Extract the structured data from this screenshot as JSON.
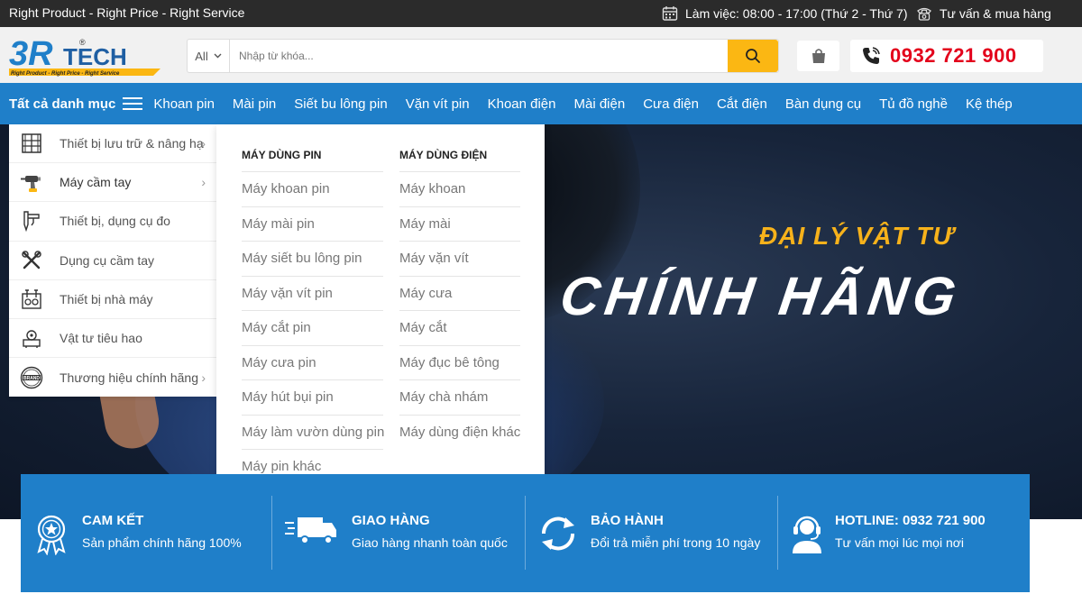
{
  "topbar": {
    "slogan": "Right Product - Right Price - Right Service",
    "hours": "Làm việc: 08:00 - 17:00 (Thứ 2 - Thứ 7)",
    "consult": "Tư vấn & mua hàng"
  },
  "header": {
    "logo_text": "3R TECH",
    "logo_tagline": "Right Product - Right Price - Right Service",
    "search_category": "All",
    "search_placeholder": "Nhập từ khóa...",
    "phone": "0932 721 900"
  },
  "nav": {
    "all_categories": "Tất cả danh mục",
    "items": [
      "Khoan pin",
      "Mài pin",
      "Siết bu lông pin",
      "Vặn vít pin",
      "Khoan điện",
      "Mài điện",
      "Cưa điện",
      "Cắt điện",
      "Bàn dụng cụ",
      "Tủ đồ nghề",
      "Kệ thép"
    ]
  },
  "sidebar": {
    "items": [
      {
        "label": "Thiết bị lưu trữ & nâng hạ",
        "icon": "shelf-icon",
        "has_sub": true
      },
      {
        "label": "Máy cầm tay",
        "icon": "drill-icon",
        "has_sub": true
      },
      {
        "label": "Thiết bị, dụng cụ đo",
        "icon": "caliper-icon",
        "has_sub": false
      },
      {
        "label": "Dụng cụ cầm tay",
        "icon": "tools-icon",
        "has_sub": false
      },
      {
        "label": "Thiết bị nhà máy",
        "icon": "factory-tools-icon",
        "has_sub": false
      },
      {
        "label": "Vật tư tiêu hao",
        "icon": "consumables-icon",
        "has_sub": false
      },
      {
        "label": "Thương hiệu chính hãng",
        "icon": "brand-icon",
        "has_sub": true
      }
    ]
  },
  "mega": {
    "col1": {
      "title": "MÁY DÙNG PIN",
      "links": [
        "Máy khoan pin",
        "Máy mài pin",
        "Máy siết bu lông pin",
        "Máy vặn vít pin",
        "Máy cắt pin",
        "Máy cưa pin",
        "Máy hút bụi pin",
        "Máy làm vườn dùng pin",
        "Máy pin khác"
      ]
    },
    "col2": {
      "title": "MÁY DÙNG ĐIỆN",
      "links": [
        "Máy khoan",
        "Máy mài",
        "Máy vặn vít",
        "Máy cưa",
        "Máy cắt",
        "Máy đục bê tông",
        "Máy chà nhám",
        "Máy dùng điện khác"
      ]
    }
  },
  "hero": {
    "line1": "ĐẠI LÝ VẬT TƯ",
    "line2": "CHÍNH HÃNG"
  },
  "services": [
    {
      "title": "CAM KẾT",
      "desc": "Sản phẩm chính hãng 100%",
      "icon": "award-icon"
    },
    {
      "title": "GIAO HÀNG",
      "desc": "Giao hàng nhanh toàn quốc",
      "icon": "truck-icon"
    },
    {
      "title": "BẢO HÀNH",
      "desc": "Đổi trả miễn phí trong 10 ngày",
      "icon": "refresh-icon"
    },
    {
      "title": "HOTLINE: 0932 721 900",
      "desc": "Tư vấn mọi lúc mọi nơi",
      "icon": "support-agent-icon"
    }
  ],
  "colors": {
    "primary": "#1f7fc9",
    "accent": "#fbb713",
    "phone": "#e3001b",
    "topbar": "#2b2b2b"
  }
}
